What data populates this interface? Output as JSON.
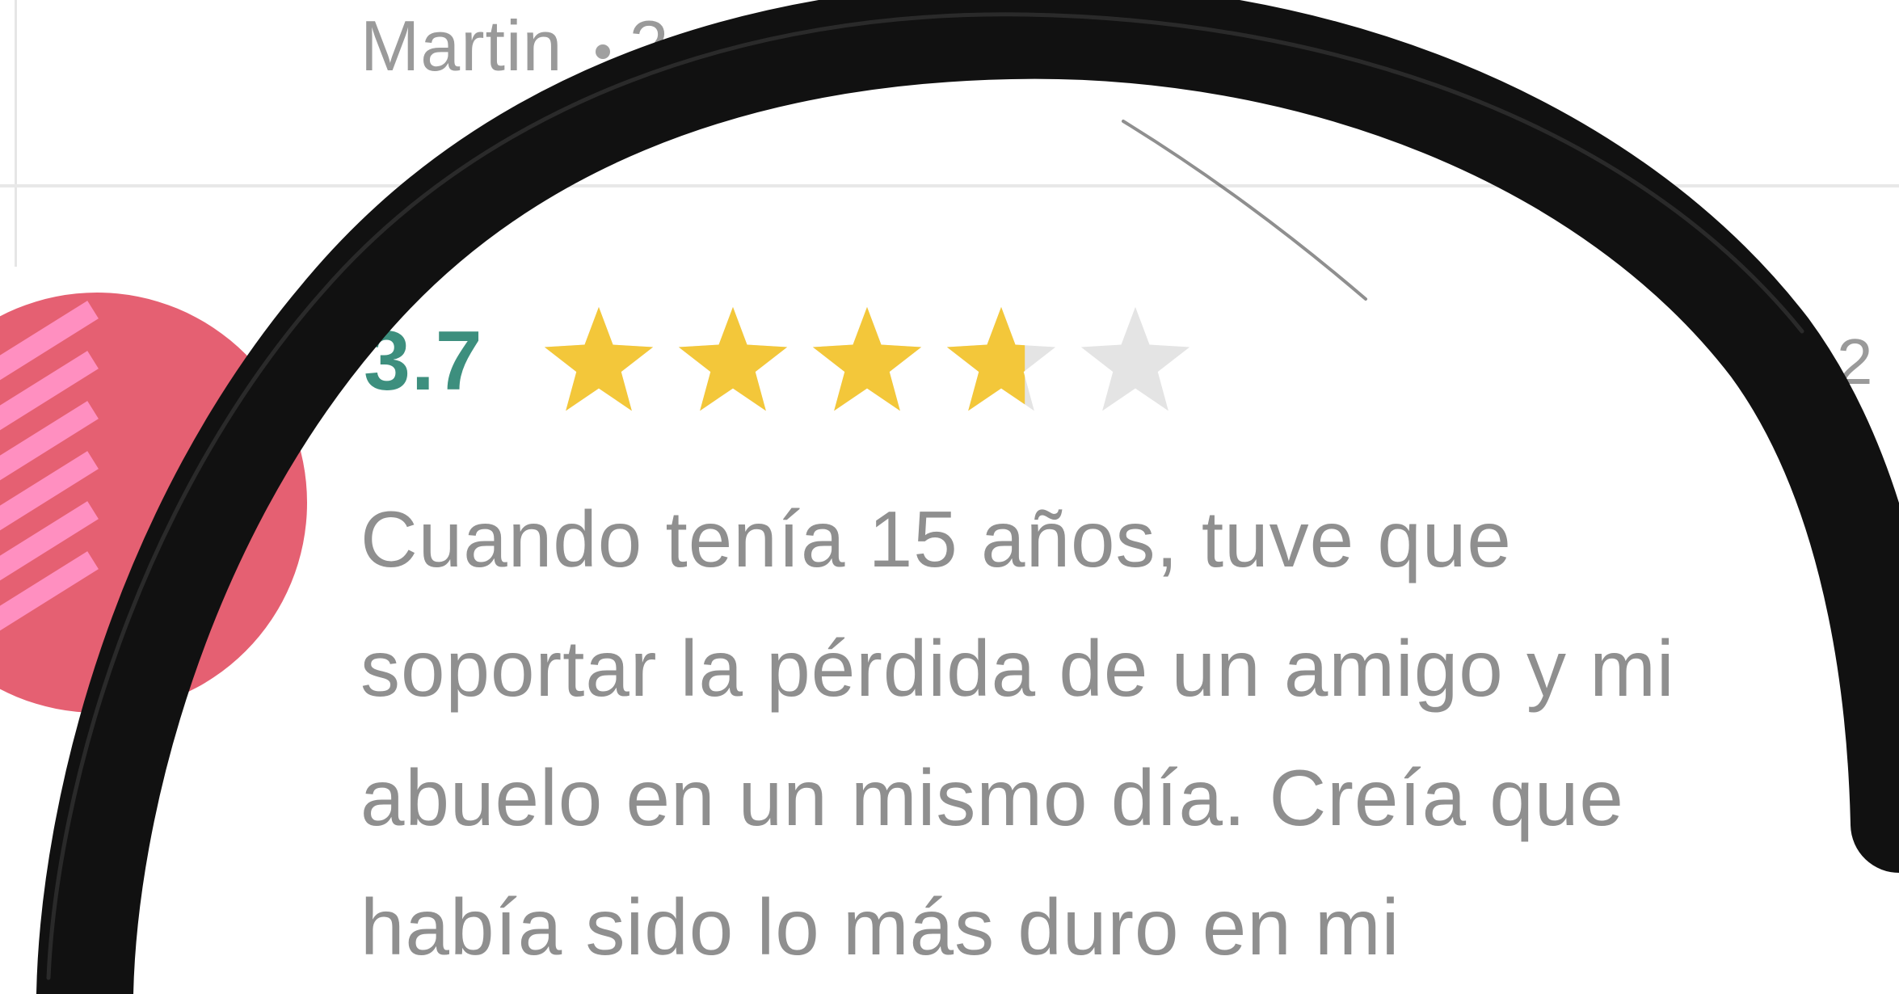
{
  "previous_review": {
    "author": "Martin",
    "date_partial": "2"
  },
  "review": {
    "rating_value": "3.7",
    "rating": 3.7,
    "rating_max": 5,
    "date_partial": "ov. 2",
    "text": "Cuando tenía 15 años, tuve que soportar la pérdida de un amigo y mi abuelo en un mismo día. Creía que había sido lo más duro en mi"
  },
  "colors": {
    "rating_text": "#3d8f7e",
    "star_filled": "#f3c73a",
    "star_empty": "#e4e4e4",
    "body_text": "#8f8f8f",
    "avatar_bg": "#e56072",
    "avatar_stripe": "#ff8fc0",
    "ink": "#111111"
  },
  "icons": {
    "star": "star-icon",
    "avatar": "avatar-pattern"
  }
}
